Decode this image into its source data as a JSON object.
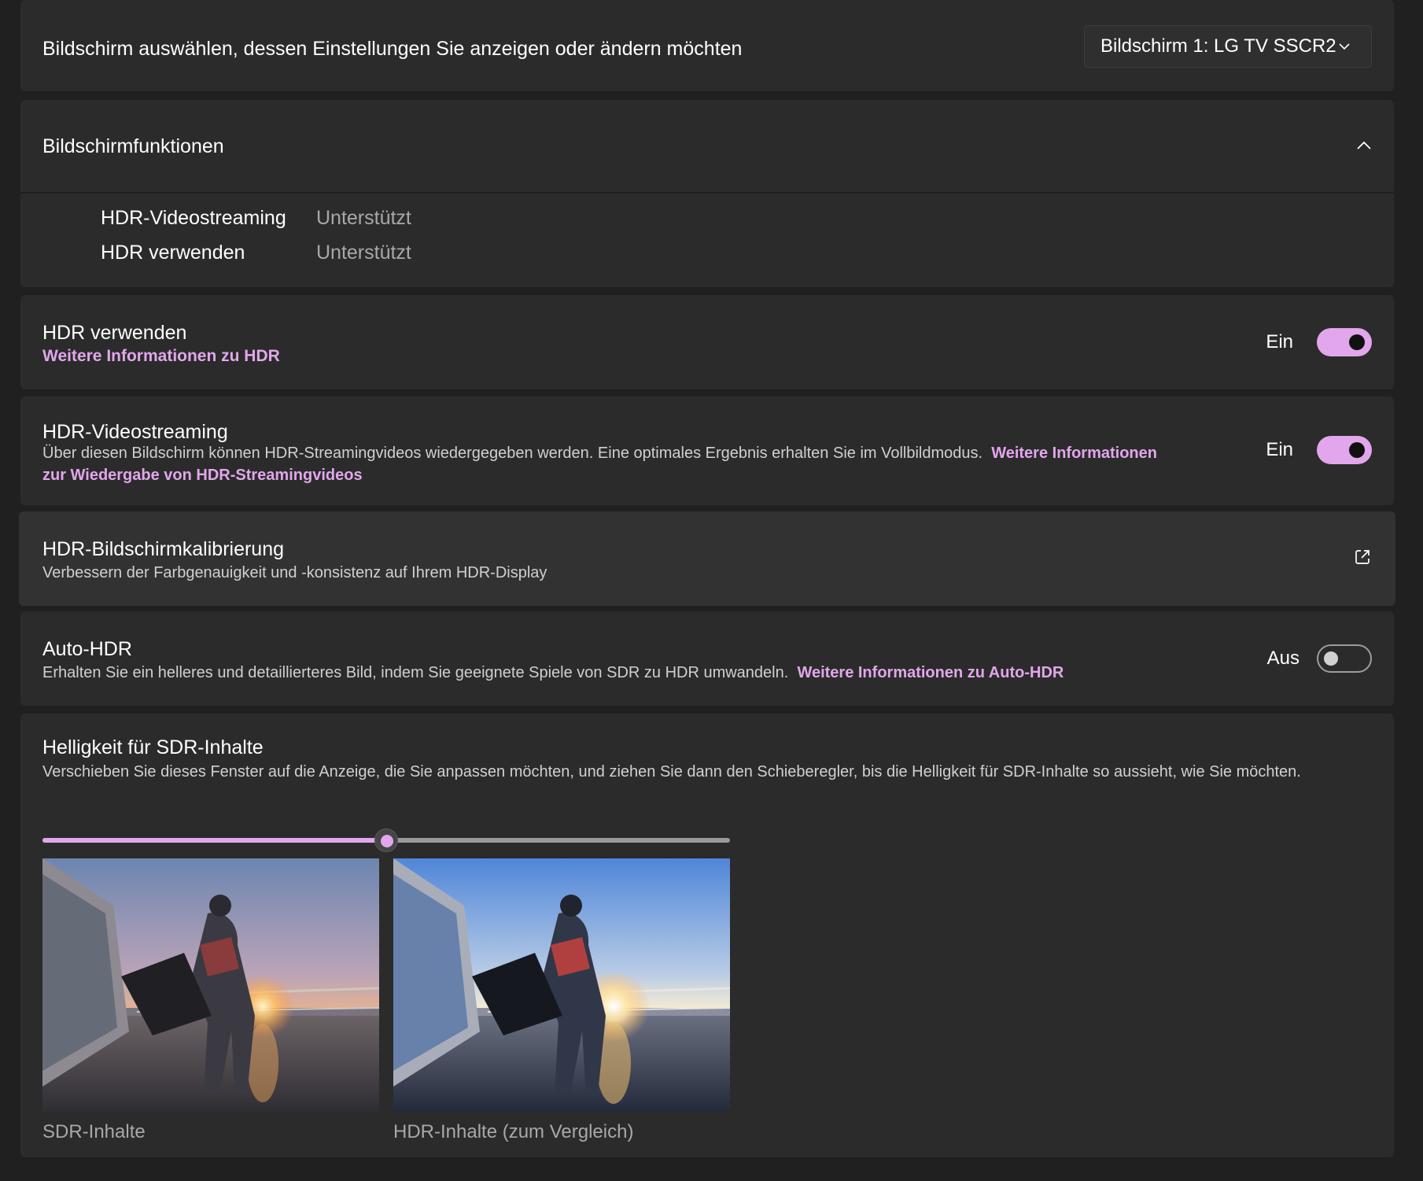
{
  "display_select": {
    "label": "Bildschirm auswählen, dessen Einstellungen Sie anzeigen oder ändern möchten",
    "selected": "Bildschirm 1: LG TV SSCR2"
  },
  "capabilities": {
    "title": "Bildschirmfunktionen",
    "rows": [
      {
        "name": "HDR-Videostreaming",
        "value": "Unterstützt"
      },
      {
        "name": "HDR verwenden",
        "value": "Unterstützt"
      }
    ]
  },
  "use_hdr": {
    "title": "HDR verwenden",
    "link": "Weitere Informationen zu HDR",
    "state": "Ein"
  },
  "hdr_streaming": {
    "title": "HDR-Videostreaming",
    "description": "Über diesen Bildschirm können HDR-Streamingvideos wiedergegeben werden. Eine optimales Ergebnis erhalten Sie im Vollbildmodus.",
    "link_part1": "Weitere Informationen",
    "link_part2": "zur Wiedergabe von HDR-Streamingvideos",
    "state": "Ein"
  },
  "calibration": {
    "title": "HDR-Bildschirmkalibrierung",
    "description": "Verbessern der Farbgenauigkeit und -konsistenz auf Ihrem HDR-Display"
  },
  "auto_hdr": {
    "title": "Auto-HDR",
    "description": "Erhalten Sie ein helleres und detaillierteres Bild, indem Sie geeignete Spiele von SDR zu HDR umwandeln.",
    "link": "Weitere Informationen zu Auto-HDR",
    "state": "Aus"
  },
  "sdr_brightness": {
    "title": "Helligkeit für SDR-Inhalte",
    "description": "Verschieben Sie dieses Fenster auf die Anzeige, die Sie anpassen möchten, und ziehen Sie dann den Schieberegler, bis die Helligkeit für SDR-Inhalte so aussieht, wie Sie möchten.",
    "slider_fraction": 0.5,
    "sdr_caption": "SDR-Inhalte",
    "hdr_caption": "HDR-Inhalte (zum Vergleich)"
  },
  "colors": {
    "accent": "#e2a6ec",
    "card": "#2b2b2b",
    "background": "#202020"
  },
  "icons": {
    "dropdown": "chevron-down-icon",
    "collapse": "chevron-up-icon",
    "external": "open-external-icon"
  }
}
